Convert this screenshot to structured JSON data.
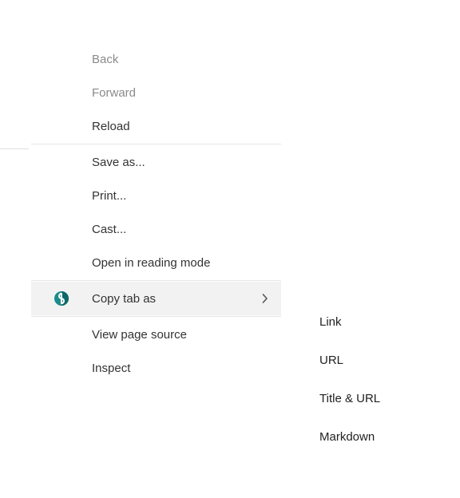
{
  "menu": {
    "items": [
      {
        "label": "Back",
        "disabled": true
      },
      {
        "label": "Forward",
        "disabled": true
      },
      {
        "label": "Reload"
      },
      {
        "separator": true
      },
      {
        "label": "Save as..."
      },
      {
        "label": "Print..."
      },
      {
        "label": "Cast..."
      },
      {
        "label": "Open in reading mode"
      },
      {
        "separator": true
      },
      {
        "label": "Copy tab as",
        "highlighted": true,
        "hasSubmenu": true,
        "icon": "extension-icon"
      },
      {
        "separator": true
      },
      {
        "label": "View page source"
      },
      {
        "label": "Inspect"
      }
    ]
  },
  "submenu": {
    "items": [
      {
        "label": "Link"
      },
      {
        "label": "URL"
      },
      {
        "label": "Title & URL"
      },
      {
        "label": "Markdown"
      }
    ]
  }
}
